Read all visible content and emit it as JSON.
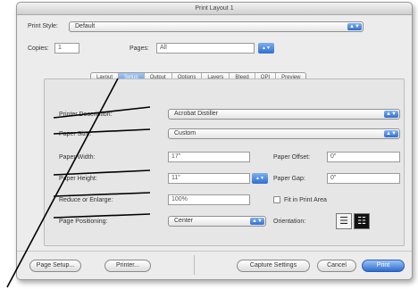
{
  "window": {
    "title": "Print Layout 1"
  },
  "top": {
    "print_style_label": "Print Style:",
    "print_style_value": "Default",
    "copies_label": "Copies:",
    "copies_value": "1",
    "pages_label": "Pages:",
    "pages_value": "All"
  },
  "tabs": [
    {
      "label": "Layout",
      "active": false
    },
    {
      "label": "Setup",
      "active": true
    },
    {
      "label": "Output",
      "active": false
    },
    {
      "label": "Options",
      "active": false
    },
    {
      "label": "Layers",
      "active": false
    },
    {
      "label": "Bleed",
      "active": false
    },
    {
      "label": "OPI",
      "active": false
    },
    {
      "label": "Preview",
      "active": false
    }
  ],
  "setup": {
    "printer_description_label": "Printer Description:",
    "printer_description_value": "Acrobat Distiller",
    "paper_size_label": "Paper Size:",
    "paper_size_value": "Custom",
    "paper_width_label": "Paper Width:",
    "paper_width_value": "17\"",
    "paper_offset_label": "Paper Offset:",
    "paper_offset_value": "0\"",
    "paper_height_label": "Paper Height:",
    "paper_height_value": "11\"",
    "paper_gap_label": "Paper Gap:",
    "paper_gap_value": "0\"",
    "reduce_enlarge_label": "Reduce or Enlarge:",
    "reduce_enlarge_value": "100%",
    "fit_label": "Fit in Print Area",
    "page_positioning_label": "Page Positioning:",
    "page_positioning_value": "Center",
    "orientation_label": "Orientation:"
  },
  "buttons": {
    "page_setup": "Page Setup...",
    "printer": "Printer...",
    "capture_settings": "Capture Settings",
    "cancel": "Cancel",
    "print": "Print"
  },
  "colors": {
    "accent": "#2f6fd1",
    "panel": "#e6e6e6"
  },
  "icons": {
    "orientation_portrait": "portrait-orientation-icon",
    "orientation_landscape": "landscape-orientation-icon"
  }
}
